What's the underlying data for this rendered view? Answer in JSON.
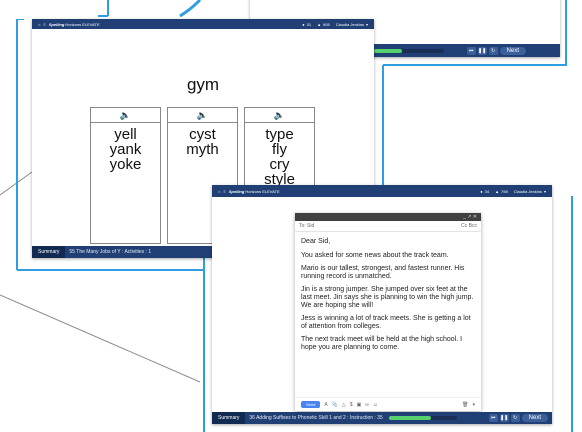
{
  "back_window": {
    "next_label": "Next"
  },
  "window1": {
    "header": {
      "brand": "Spelling",
      "brand_product": "Horizons ELEVATE",
      "stat1": "31",
      "stat2": "905",
      "user": "Claudia Jenkins"
    },
    "title_word": "gym",
    "columns": [
      {
        "words": [
          "yell",
          "yank",
          "yoke"
        ]
      },
      {
        "words": [
          "cyst",
          "myth"
        ]
      },
      {
        "words": [
          "type",
          "fly",
          "cry",
          "style"
        ]
      }
    ],
    "footer": {
      "summary_label": "Summary",
      "lesson": "55 The Many Jobs of Y : Activities : 1"
    }
  },
  "window2": {
    "header": {
      "brand": "Spelling",
      "brand_product": "Horizons ELEVATE",
      "stat1": "34",
      "stat2": "798",
      "user": "Claudia Jenkins"
    },
    "email": {
      "window_controls": "_ ↗ ✕",
      "to_label": "To: Sid",
      "cc_bcc": "Cc Bcc",
      "greeting": "Dear Sid,",
      "paragraphs": [
        "You asked for some news about the track team.",
        "Mario is our tallest, strongest, and fastest runner. His running record is unmatched.",
        "Jin is a strong jumper. She jumped over six feet at the last meet. Jin says she is planning to win the high jump. We are hoping she will!",
        "Jess is winning a lot of track meets. She is getting a lot of attention from colleges.",
        "The next track meet will be held at the high school. I hope you are planning to come."
      ],
      "send_label": "Send"
    },
    "footer": {
      "summary_label": "Summary",
      "lesson": "36 Adding Suffixes to Phonetic Skill 1 and 2 : Instruction : 35",
      "progress": 0.62,
      "next_label": "Next"
    }
  },
  "colors": {
    "frame_blue": "#2f9de0",
    "bar_navy": "#1f3f75",
    "progress_green": "#55d16d",
    "speaker_blue": "#2f7ed8"
  }
}
